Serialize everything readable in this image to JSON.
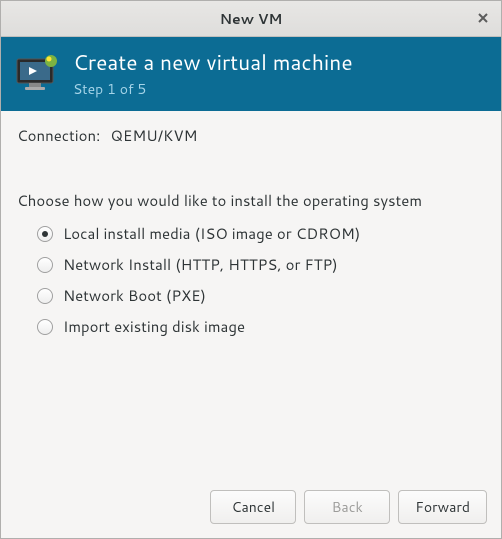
{
  "window": {
    "title": "New VM"
  },
  "header": {
    "title": "Create a new virtual machine",
    "step": "Step 1 of 5"
  },
  "connection": {
    "label": "Connection:",
    "value": "QEMU/KVM"
  },
  "choose": {
    "label": "Choose how you would like to install the operating system"
  },
  "options": [
    {
      "label": "Local install media (ISO image or CDROM)",
      "checked": true
    },
    {
      "label": "Network Install (HTTP, HTTPS, or FTP)",
      "checked": false
    },
    {
      "label": "Network Boot (PXE)",
      "checked": false
    },
    {
      "label": "Import existing disk image",
      "checked": false
    }
  ],
  "buttons": {
    "cancel": "Cancel",
    "back": "Back",
    "forward": "Forward"
  }
}
